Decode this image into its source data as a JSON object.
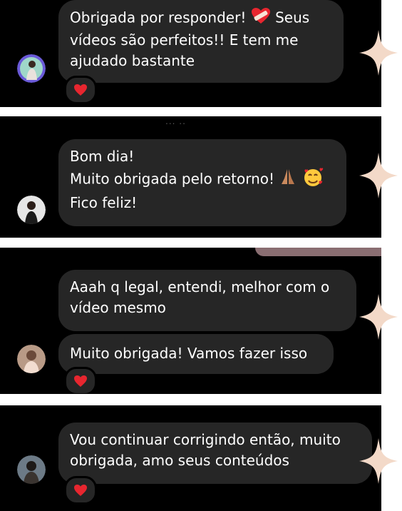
{
  "colors": {
    "panel_bg": "#000000",
    "bubble_bg": "#262626",
    "text": "#ffffff",
    "heart": "#e8262f",
    "star": "#f3d9c8",
    "page_bg": "#ffffff"
  },
  "messages": [
    {
      "lines": [
        "Obrigada por responder!",
        "vídeos são perfeitos!! E tem me",
        "ajudado bastante"
      ],
      "first_line_tail": "Seus",
      "inline_emoji": "heart-bandage-emoji",
      "reaction": "heart-icon"
    },
    {
      "faded_header": "... ..",
      "lines": [
        "Bom dia!",
        "Muito obrigada pelo retorno!",
        "Fico feliz!"
      ],
      "inline_emoji": [
        "folded-hands-emoji",
        "smiling-face-with-hearts-emoji"
      ]
    },
    {
      "lines": [
        "Aaah q legal, entendi, melhor com o",
        "vídeo mesmo"
      ],
      "second_bubble": "Muito obrigada! Vamos fazer isso",
      "reaction": "heart-icon"
    },
    {
      "lines": [
        "Vou continuar corrigindo então, muito",
        "obrigada, amo seus conteúdos"
      ],
      "reaction": "heart-icon"
    }
  ]
}
